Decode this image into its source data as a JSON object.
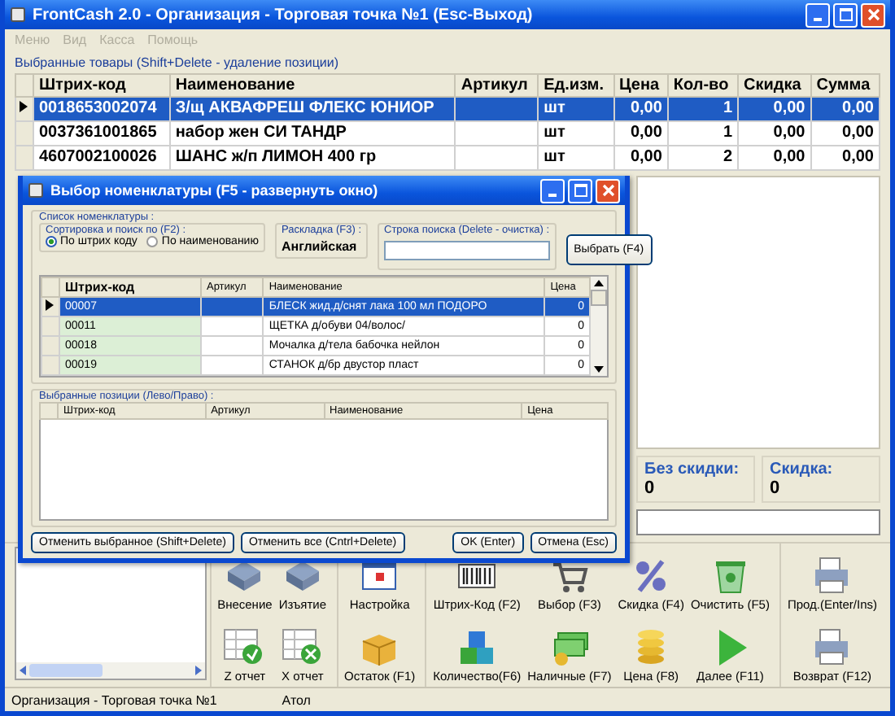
{
  "window": {
    "title": "FrontCash 2.0 - Организация - Торговая точка №1 (Esc-Выход)"
  },
  "menu": [
    {
      "label": "Меню",
      "disabled": true
    },
    {
      "label": "Вид",
      "disabled": true
    },
    {
      "label": "Касса",
      "disabled": true
    },
    {
      "label": "Помощь",
      "disabled": true
    }
  ],
  "cart": {
    "caption": "Выбранные товары (Shift+Delete - удаление позиции)",
    "columns": [
      "Штрих-код",
      "Наименование",
      "Артикул",
      "Ед.изм.",
      "Цена",
      "Кол-во",
      "Скидка",
      "Сумма"
    ],
    "rows": [
      {
        "selected": true,
        "barcode": "0018653002074",
        "name": "З/щ АКВАФРЕШ ФЛЕКС ЮНИОР",
        "unit": "шт",
        "price": "0,00",
        "qty": "1",
        "discount": "0,00",
        "sum": "0,00"
      },
      {
        "selected": false,
        "barcode": "0037361001865",
        "name": "набор жен СИ ТАНДР",
        "unit": "шт",
        "price": "0,00",
        "qty": "1",
        "discount": "0,00",
        "sum": "0,00"
      },
      {
        "selected": false,
        "barcode": "4607002100026",
        "name": "ШАНС ж/п ЛИМОН 400 гр",
        "unit": "шт",
        "price": "0,00",
        "qty": "2",
        "discount": "0,00",
        "sum": "0,00"
      }
    ]
  },
  "totals": [
    {
      "label": "Без скидки:",
      "value": "0"
    },
    {
      "label": "Скидка:",
      "value": "0"
    }
  ],
  "toolbar": [
    {
      "buttons": [
        {
          "label": "Внесение"
        },
        {
          "label": "Изъятие"
        },
        {
          "label": "Z отчет"
        },
        {
          "label": "X отчет"
        }
      ]
    },
    {
      "buttons": [
        {
          "label": "Настройка"
        },
        {
          "label": "Остаток (F1)"
        }
      ]
    },
    {
      "buttons": [
        {
          "label": "Штрих-Код (F2)"
        },
        {
          "label": "Выбор (F3)"
        },
        {
          "label": "Скидка (F4)"
        },
        {
          "label": "Очистить (F5)"
        },
        {
          "label": "Количество(F6)"
        },
        {
          "label": "Наличные (F7)"
        },
        {
          "label": "Цена (F8)"
        },
        {
          "label": "Далее (F11)"
        }
      ]
    },
    {
      "buttons": [
        {
          "label": "Прод.(Enter/Ins)"
        },
        {
          "label": "Возврат (F12)"
        }
      ]
    }
  ],
  "status_bar": [
    "Организация - Торговая точка №1",
    "Атол"
  ],
  "dialog": {
    "title": "Выбор номенклатуры (F5 - развернуть окно)",
    "list_caption": "Список номенклатуры :",
    "sort": {
      "caption": "Сортировка и поиск по (F2) :",
      "options": [
        {
          "label": "По штрих коду",
          "selected": true
        },
        {
          "label": "По наименованию",
          "selected": false
        }
      ]
    },
    "layout": {
      "caption": "Раскладка (F3) :",
      "value": "Английская"
    },
    "search": {
      "caption": "Строка поиска (Delete - очистка) :"
    },
    "select_button": "Выбрать (F4)",
    "columns": [
      "Штрих-код",
      "Артикул",
      "Наименование",
      "Цена"
    ],
    "rows": [
      {
        "selected": true,
        "barcode": "00007",
        "name": "БЛЕСК жид.д/снят лака 100 мл ПОДОРО",
        "price": "0"
      },
      {
        "selected": false,
        "barcode": "00011",
        "name": "ЩЕТКА д/обуви 04/волос/",
        "price": "0"
      },
      {
        "selected": false,
        "barcode": "00018",
        "name": "Мочалка д/тела бабочка нейлон",
        "price": "0"
      },
      {
        "selected": false,
        "barcode": "00019",
        "name": "СТАНОК д/бр двустор пласт",
        "price": "0"
      }
    ],
    "chosen": {
      "caption": "Выбранные позиции (Лево/Право) :",
      "columns": [
        "Штрих-код",
        "Артикул",
        "Наименование",
        "Цена"
      ]
    },
    "buttons": [
      {
        "label": "Отменить выбранное (Shift+Delete)"
      },
      {
        "label": "Отменить все (Cntrl+Delete)"
      },
      {
        "label": "OK (Enter)"
      },
      {
        "label": "Отмена (Esc)"
      }
    ]
  }
}
